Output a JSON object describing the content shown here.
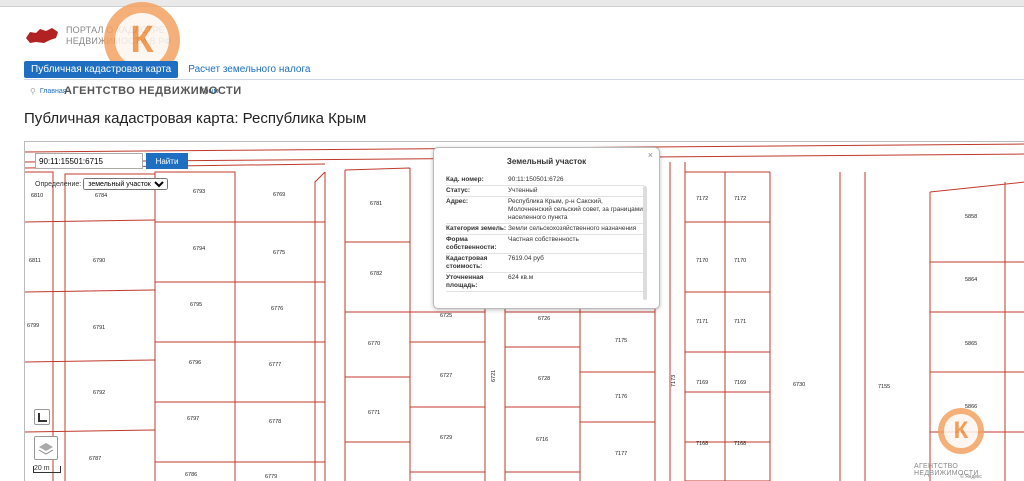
{
  "logo": {
    "line1": "ПОРТАЛ ПРОСТРАНСТВЕННЫХ",
    "line2": "ДАННЫХ И КАДАСТРА",
    "portal_l1": "ПОРТАЛ О КАДАСТРЕ",
    "portal_l2": "НЕДВИЖИМОСТИ В РФ"
  },
  "nav": {
    "active_tab": "Публичная кадастровая карта",
    "tab2": "Расчет земельного налога"
  },
  "breadcrumb": {
    "home": "Главная",
    "current": "Крым"
  },
  "watermark": {
    "agency": "АГЕНТСТВО НЕДВИЖИМОСТИ",
    "agency_footer": "АГЕНТСТВО НЕДВИЖИМОСТИ",
    "letter": "К"
  },
  "page": {
    "title": "Публичная кадастровая карта: Республика Крым"
  },
  "search": {
    "value": "90:11:15501:6715",
    "button": "Найти"
  },
  "definition": {
    "label": "Определение:",
    "selected": "земельный участок"
  },
  "scale": {
    "label": "20 m"
  },
  "popup": {
    "title": "Земельный участок",
    "close": "×",
    "rows": [
      {
        "k": "Кад. номер:",
        "v": "90:11:150501:6726"
      },
      {
        "k": "Статус:",
        "v": "Учтенный"
      },
      {
        "k": "Адрес:",
        "v": "Республика Крым, р-н Сакский, Молочненский сельский совет, за границами населенного пункта"
      },
      {
        "k": "Категория земель:",
        "v": "Земли сельскохозяйственного назначения"
      },
      {
        "k": "Форма собственности:",
        "v": "Частная собственность"
      },
      {
        "k": "Кадастровая стоимость:",
        "v": "7619.04 руб"
      },
      {
        "k": "Уточненная площадь:",
        "v": "624 кв.м"
      }
    ]
  },
  "map_labels": [
    "6784",
    "6790",
    "6791",
    "6792",
    "6787",
    "6793",
    "6794",
    "6795",
    "6796",
    "6797",
    "6786",
    "6769",
    "6775",
    "6776",
    "6777",
    "6778",
    "6779",
    "6781",
    "6782",
    "6770",
    "6771",
    "6725",
    "6727",
    "6729",
    "6721",
    "6726",
    "6728",
    "6716",
    "7175",
    "7176",
    "7177",
    "7173",
    "7172",
    "7172",
    "7170",
    "7170",
    "7171",
    "7171",
    "7169",
    "7169",
    "7168",
    "7168",
    "6730",
    "7155",
    "5858",
    "5864",
    "5865",
    "5866",
    "6810",
    "6811",
    "6799"
  ],
  "copyright": "© Яндекс"
}
